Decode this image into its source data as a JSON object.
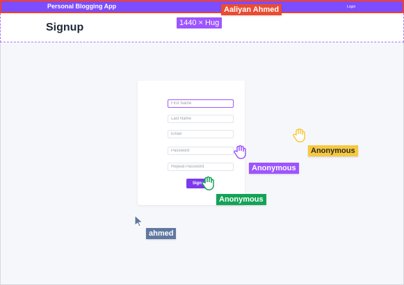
{
  "app": {
    "title": "Personal Blogging App",
    "nav_login": "Login"
  },
  "header": {
    "page_title": "Signup",
    "size_badge": "1440 × Hug"
  },
  "form": {
    "fields": [
      {
        "placeholder": "First Name"
      },
      {
        "placeholder": "Last Name"
      },
      {
        "placeholder": "Email"
      },
      {
        "placeholder": "Password"
      },
      {
        "placeholder": "Repeat Password"
      }
    ],
    "submit_label": "Signup"
  },
  "collaborators": [
    {
      "name": "Aaliyan Ahmed",
      "color": "#ea4b32"
    },
    {
      "name": "Anonymous",
      "color": "#f7c93f"
    },
    {
      "name": "Anonymous",
      "color": "#9d55ff"
    },
    {
      "name": "Anonymous",
      "color": "#14a356"
    },
    {
      "name": "ahmed",
      "color": "#6078a0"
    }
  ],
  "colors": {
    "topbar": "#7c4dff",
    "selection": "#9d55ff",
    "button": "#7c3aed"
  }
}
